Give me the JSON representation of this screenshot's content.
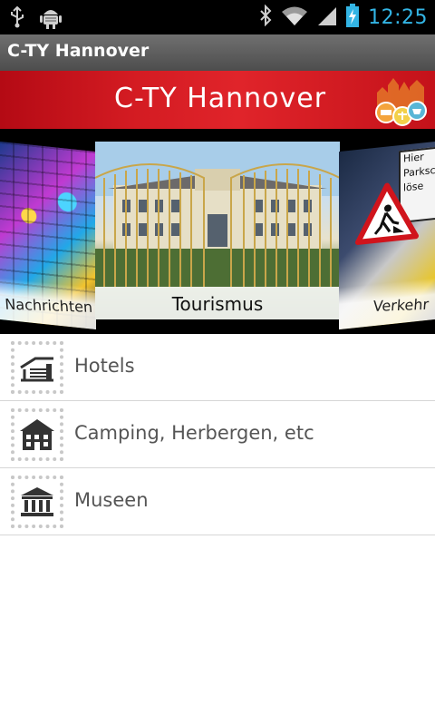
{
  "status_bar": {
    "time": "12:25",
    "icons": [
      "usb-icon",
      "android-debug-icon",
      "bluetooth-icon",
      "wifi-icon",
      "signal-icon",
      "battery-charging-icon"
    ]
  },
  "app": {
    "title": "C-TY Hannover"
  },
  "banner": {
    "logo_text": "C-TY Hannover"
  },
  "carousel": {
    "left": {
      "caption": "Nachrichten"
    },
    "center": {
      "caption": "Tourismus"
    },
    "right": {
      "caption": "Verkehr",
      "sign_text": [
        "Hier",
        "Parksc",
        "löse"
      ]
    }
  },
  "list": {
    "items": [
      {
        "label": "Hotels",
        "icon": "hotel-icon"
      },
      {
        "label": "Camping, Herbergen, etc",
        "icon": "hostel-icon"
      },
      {
        "label": "Museen",
        "icon": "museum-icon"
      }
    ]
  },
  "colors": {
    "status_bg": "#000000",
    "clock": "#33b5e5",
    "title_bar": "#5a5a5a",
    "banner_red": "#d31b22",
    "list_text": "#555555",
    "divider": "#d6d6d6"
  }
}
